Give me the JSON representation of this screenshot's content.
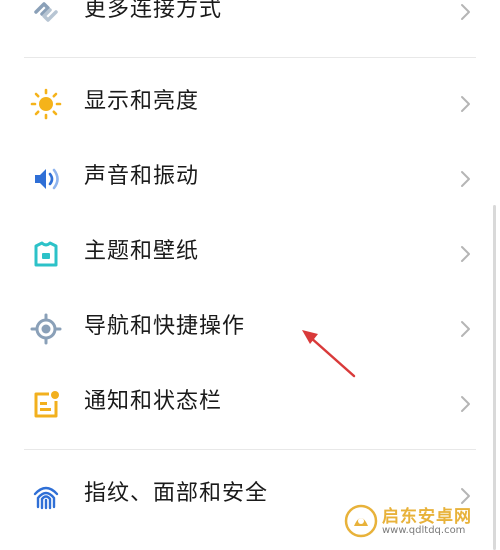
{
  "settings_list": {
    "items": [
      {
        "label": "更多连接方式",
        "icon": "link-icon",
        "icon_color": "#8aa0b8"
      },
      {
        "label": "显示和亮度",
        "icon": "sun-icon",
        "icon_color": "#f5b31a"
      },
      {
        "label": "声音和振动",
        "icon": "speaker-icon",
        "icon_color": "#2f6fd6"
      },
      {
        "label": "主题和壁纸",
        "icon": "theme-shirt-icon",
        "icon_color": "#2cc2c8"
      },
      {
        "label": "导航和快捷操作",
        "icon": "navigation-target-icon",
        "icon_color": "#8aa0b8"
      },
      {
        "label": "通知和状态栏",
        "icon": "notification-icon",
        "icon_color": "#f2b01e"
      },
      {
        "label": "指纹、面部和安全",
        "icon": "fingerprint-icon",
        "icon_color": "#2f6fd6"
      }
    ]
  },
  "annotation": {
    "color": "#d93a3a",
    "icon": "red-arrow-icon"
  },
  "watermark": {
    "name": "启东安卓网",
    "url": "www.qdltdq.com",
    "color": "#e8b23a"
  }
}
